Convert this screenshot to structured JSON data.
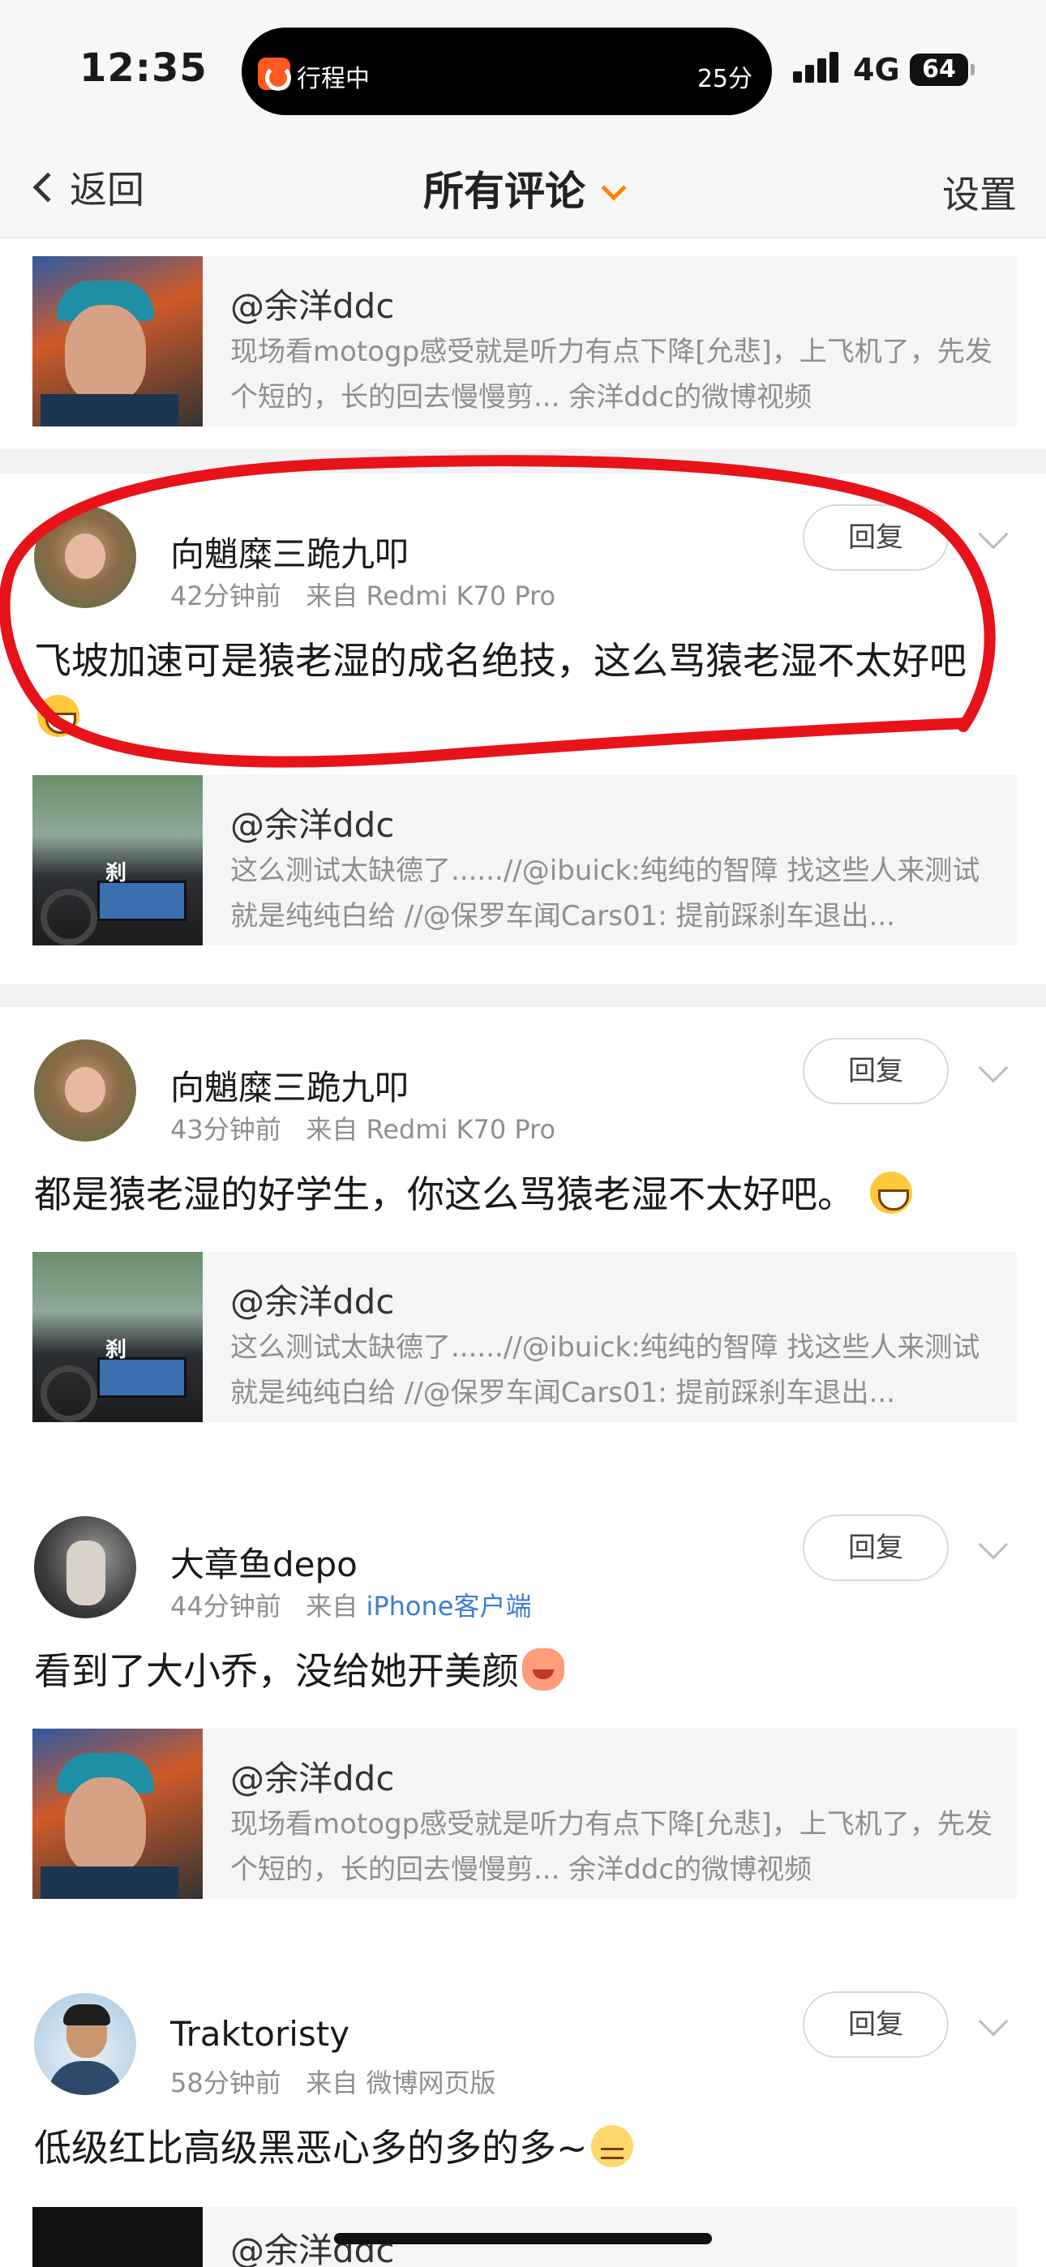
{
  "status_bar": {
    "time": "12:35",
    "live_activity": {
      "label": "行程中",
      "eta": "25分"
    },
    "network": "4G",
    "battery": "64"
  },
  "nav": {
    "back_label": "返回",
    "title": "所有评论",
    "settings_label": "设置"
  },
  "comments": [
    {
      "quote": {
        "user": "@余洋ddc",
        "text": "现场看motogp感受就是听力有点下降[允悲]，上飞机了，先发个短的，长的回去慢慢剪... 余洋ddc的微博视频"
      }
    },
    {
      "username": "向魈糜三跪九叩",
      "time": "42分钟前",
      "source_prefix": "来自",
      "source": "Redmi K70 Pro",
      "text": "飞坡加速可是猿老湿的成名绝技，这么骂猿老湿不太好吧",
      "reply_label": "回复",
      "quote": {
        "user": "@余洋ddc",
        "text": "这么测试太缺德了......//@ibuick:纯纯的智障 找这些人来测试 就是纯纯白给 //@保罗车闻Cars01: 提前踩刹车退出..."
      }
    },
    {
      "username": "向魈糜三跪九叩",
      "time": "43分钟前",
      "source_prefix": "来自",
      "source": "Redmi K70 Pro",
      "text": "都是猿老湿的好学生，你这么骂猿老湿不太好吧。",
      "reply_label": "回复",
      "quote": {
        "user": "@余洋ddc",
        "text": "这么测试太缺德了......//@ibuick:纯纯的智障 找这些人来测试 就是纯纯白给 //@保罗车闻Cars01: 提前踩刹车退出..."
      }
    },
    {
      "username": "大章鱼depo",
      "time": "44分钟前",
      "source_prefix": "来自",
      "source": "iPhone客户端",
      "text": "看到了大小乔，没给她开美颜",
      "reply_label": "回复",
      "quote": {
        "user": "@余洋ddc",
        "text": "现场看motogp感受就是听力有点下降[允悲]，上飞机了，先发个短的，长的回去慢慢剪... 余洋ddc的微博视频"
      }
    },
    {
      "username": "Traktoristy",
      "time": "58分钟前",
      "source_prefix": "来自",
      "source": "微博网页版",
      "text": "低级红比高级黑恶心多的多的多~",
      "reply_label": "回复",
      "quote": {
        "user": "@余洋ddc"
      }
    }
  ],
  "colors": {
    "accent_orange": "#ff8200",
    "link_blue": "#3c7cd6",
    "annotation_red": "#e8121a"
  }
}
